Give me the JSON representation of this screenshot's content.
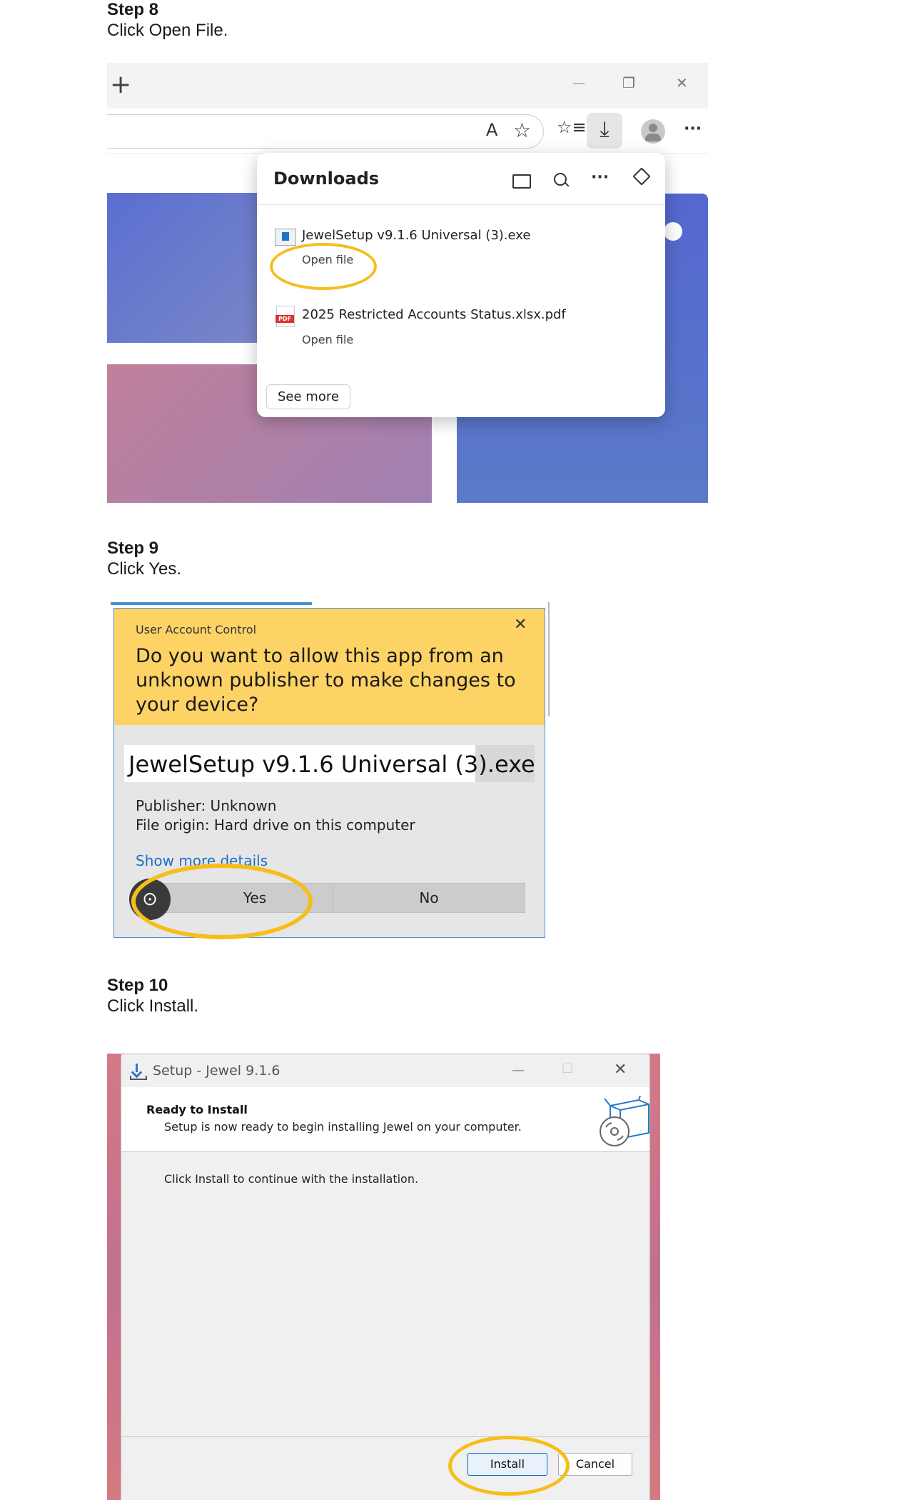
{
  "step8": {
    "title": "Step 8",
    "description": "Click Open File.",
    "browser": {
      "new_tab_glyph": "+",
      "minimize_glyph": "—",
      "restore_glyph": "❐",
      "close_glyph": "✕",
      "read_aloud_glyph": "A",
      "favorite_glyph": "☆",
      "favorites_glyph": "☆≡",
      "download_glyph": "⤓",
      "more_glyph": "···",
      "downloads_panel": {
        "title": "Downloads",
        "folder_glyph": "▭",
        "search_glyph": "⚲",
        "more_glyph": "···",
        "pin_glyph": "⚲",
        "items": [
          {
            "name": "JewelSetup v9.1.6 Universal (3).exe",
            "action": "Open file",
            "icon": "exe-file-icon"
          },
          {
            "name": "2025 Restricted Accounts Status.xlsx.pdf",
            "action": "Open file",
            "icon": "pdf-file-icon",
            "icon_text": "PDF"
          }
        ],
        "see_more": "See more"
      }
    }
  },
  "step9": {
    "title": "Step 9",
    "description": "Click Yes.",
    "uac": {
      "label": "User Account Control",
      "close_glyph": "✕",
      "question": "Do you want to allow this app from an unknown publisher to make changes to your device?",
      "app_name": "JewelSetup v9.1.6 Universal (3).exe",
      "publisher": "Publisher: Unknown",
      "origin": "File origin: Hard drive on this computer",
      "more_details": "Show more details",
      "yes": "Yes",
      "no": "No",
      "lens_glyph": "⊙"
    }
  },
  "step10": {
    "title": "Step 10",
    "description": "Click Install.",
    "setup": {
      "title": "Setup - Jewel 9.1.6",
      "minimize_glyph": "—",
      "maximize_glyph": "☐",
      "close_glyph": "✕",
      "ready_title": "Ready to Install",
      "ready_subtitle": "Setup is now ready to begin installing Jewel on your computer.",
      "body": "Click Install to continue with the installation.",
      "install": "Install",
      "cancel": "Cancel"
    }
  },
  "colors": {
    "highlight_ring": "#f5be1b",
    "uac_header": "#fed366",
    "link_blue": "#1e6fc7"
  }
}
